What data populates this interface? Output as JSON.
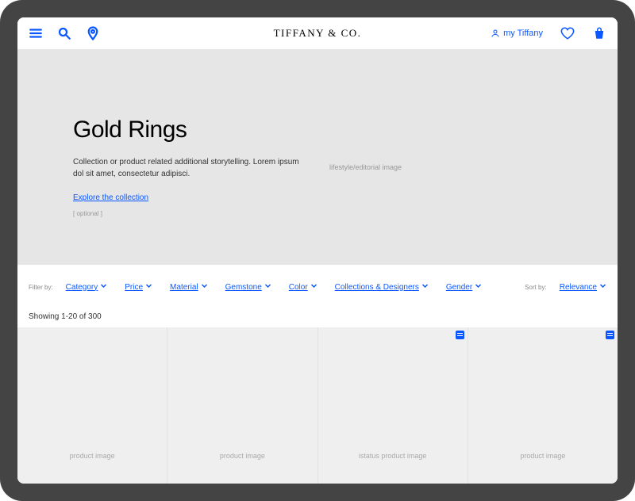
{
  "header": {
    "brand": "TIFFANY & CO.",
    "my_account_label": "my Tiffany"
  },
  "hero": {
    "title": "Gold Rings",
    "description": "Collection or product related additional storytelling. Lorem ipsum dol sit amet, consectetur adipisci.",
    "cta_label": "Explore the collection",
    "optional_note": "[ optional ]",
    "image_placeholder": "lifestyle/editorial image"
  },
  "filters": {
    "filter_by_label": "Filter by:",
    "sort_by_label": "Sort by:",
    "items": [
      "Category",
      "Price",
      "Material",
      "Gemstone",
      "Color",
      "Collections & Designers",
      "Gender"
    ],
    "sort_value": "Relevance"
  },
  "results": {
    "count_text": "Showing 1-20 of 300"
  },
  "products": [
    {
      "placeholder": "product image",
      "status": false
    },
    {
      "placeholder": "product image",
      "status": false
    },
    {
      "placeholder": "istatus product image",
      "status": true
    },
    {
      "placeholder": "product image",
      "status": true
    }
  ],
  "colors": {
    "accent": "#0b57ff"
  }
}
